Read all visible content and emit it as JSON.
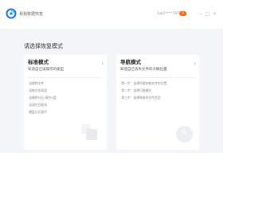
{
  "app": {
    "name": "易我数据恢复"
  },
  "header": {
    "account": "1@2****7875",
    "vip_badge": "V"
  },
  "window_controls": {
    "minimize": "−",
    "maximize": "□",
    "close": "✕"
  },
  "page_title": "请选择恢复模式",
  "cards": [
    {
      "title": "标准模式",
      "subtitle": "知道自己误操作的类型",
      "items": [
        "·误删除文件",
        "·误格式化磁盘",
        "·误删除分区/清空U盘",
        "·误清空回收站",
        "·硬盘分区损坏"
      ],
      "icon": "stacked-squares-icon"
    },
    {
      "title": "导航模式",
      "subtitle": "知道自己丢失文件的大概位置",
      "items": [
        "·第一步：选择所要恢复文件的位置",
        "·第二步：选择扫描模式",
        "·第三步：选择恢复的文件类型"
      ],
      "icon": "pencil-icon"
    }
  ],
  "colors": {
    "accent": "#ff6a00",
    "brand_blue": "#1a73e8",
    "background": "#f4f5f8"
  }
}
